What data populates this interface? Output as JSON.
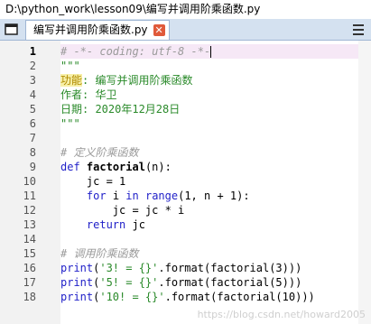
{
  "window": {
    "title": "D:\\python_work\\lesson09\\编写并调用阶乘函数.py"
  },
  "tab": {
    "label": "编写并调用阶乘函数.py",
    "close_glyph": "✕"
  },
  "editor": {
    "line_numbers": [
      "1",
      "2",
      "3",
      "4",
      "5",
      "6",
      "7",
      "8",
      "9",
      "10",
      "11",
      "12",
      "13",
      "14",
      "15",
      "16",
      "17",
      "18"
    ],
    "current_line": "1",
    "lines": {
      "l1": "# -*- coding: utf-8 -*-",
      "l2": "\"\"\"",
      "l3_key": "功能",
      "l3_val": ": 编写并调用阶乘函数",
      "l4": "作者: 华卫",
      "l5": "日期: 2020年12月28日",
      "l6": "\"\"\"",
      "l8": "# 定义阶乘函数",
      "l9_kw": "def",
      "l9_fn": "factorial",
      "l9_rest": "(n):",
      "l10": "    jc = 1",
      "l11_indent": "    ",
      "l11_for": "for",
      "l11_i": " i ",
      "l11_in": "in",
      "l11_sp": " ",
      "l11_range": "range",
      "l11_rest": "(1, n + 1):",
      "l12": "        jc = jc * i",
      "l13_indent": "    ",
      "l13_kw": "return",
      "l13_rest": " jc",
      "l15": "# 调用阶乘函数",
      "l16_print": "print",
      "l16_p1": "(",
      "l16_str": "'3! = {}'",
      "l16_rest": ".format(factorial(3)))",
      "l17_print": "print",
      "l17_p1": "(",
      "l17_str": "'5! = {}'",
      "l17_rest": ".format(factorial(5)))",
      "l18_print": "print",
      "l18_p1": "(",
      "l18_str": "'10! = {}'",
      "l18_rest": ".format(factorial(10)))"
    }
  },
  "watermark": "https://blog.csdn.net/howard2005",
  "colors": {
    "tabbar": "#d4e1f0",
    "keyword": "#1f1fc8",
    "string": "#2a8a2a",
    "comment": "#9a9a9a",
    "current_line": "#f6e8f6"
  },
  "icons": {
    "tab_list": "window-icon",
    "tab_close": "close-icon",
    "menu": "hamburger-menu-icon"
  }
}
